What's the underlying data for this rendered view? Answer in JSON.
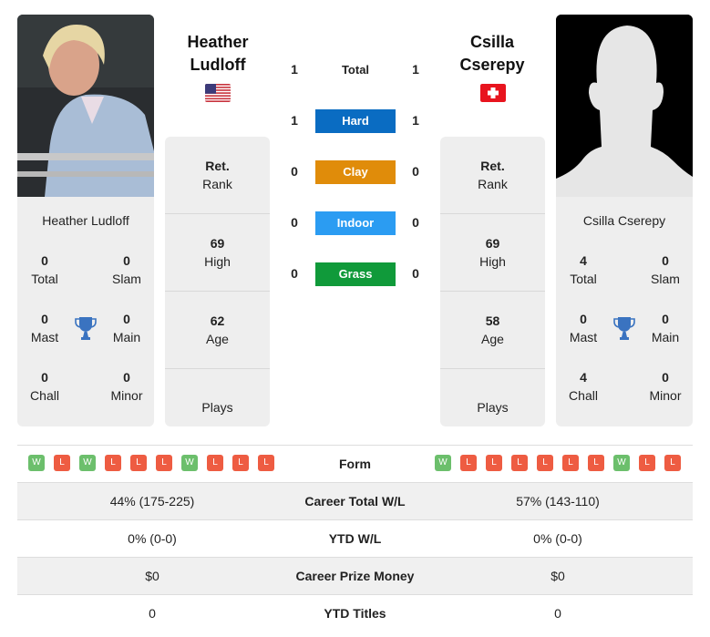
{
  "players": {
    "left": {
      "name": "Heather Ludloff",
      "name_line1": "Heather",
      "name_line2": "Ludloff",
      "country": "USA",
      "flag_icon": "us-flag-icon",
      "titles": {
        "total": {
          "value": "0",
          "label": "Total"
        },
        "slam": {
          "value": "0",
          "label": "Slam"
        },
        "mast": {
          "value": "0",
          "label": "Mast"
        },
        "main": {
          "value": "0",
          "label": "Main"
        },
        "chall": {
          "value": "0",
          "label": "Chall"
        },
        "minor": {
          "value": "0",
          "label": "Minor"
        }
      },
      "info": {
        "rank": {
          "value": "Ret.",
          "label": "Rank"
        },
        "high": {
          "value": "69",
          "label": "High"
        },
        "age": {
          "value": "62",
          "label": "Age"
        },
        "plays": {
          "value": "",
          "label": "Plays"
        }
      },
      "form": [
        "W",
        "L",
        "W",
        "L",
        "L",
        "L",
        "W",
        "L",
        "L",
        "L"
      ]
    },
    "right": {
      "name": "Csilla Cserepy",
      "name_line1": "Csilla",
      "name_line2": "Cserepy",
      "country": "Switzerland",
      "flag_icon": "swiss-flag-icon",
      "titles": {
        "total": {
          "value": "4",
          "label": "Total"
        },
        "slam": {
          "value": "0",
          "label": "Slam"
        },
        "mast": {
          "value": "0",
          "label": "Mast"
        },
        "main": {
          "value": "0",
          "label": "Main"
        },
        "chall": {
          "value": "4",
          "label": "Chall"
        },
        "minor": {
          "value": "0",
          "label": "Minor"
        }
      },
      "info": {
        "rank": {
          "value": "Ret.",
          "label": "Rank"
        },
        "high": {
          "value": "69",
          "label": "High"
        },
        "age": {
          "value": "58",
          "label": "Age"
        },
        "plays": {
          "value": "",
          "label": "Plays"
        }
      },
      "form": [
        "W",
        "L",
        "L",
        "L",
        "L",
        "L",
        "L",
        "W",
        "L",
        "L"
      ]
    }
  },
  "h2h": [
    {
      "label": "Total",
      "left": "1",
      "right": "1",
      "color": ""
    },
    {
      "label": "Hard",
      "left": "1",
      "right": "1",
      "color": "#0a6cc2"
    },
    {
      "label": "Clay",
      "left": "0",
      "right": "0",
      "color": "#e08c0a"
    },
    {
      "label": "Indoor",
      "left": "0",
      "right": "0",
      "color": "#2b9cf2"
    },
    {
      "label": "Grass",
      "left": "0",
      "right": "0",
      "color": "#109a3a"
    }
  ],
  "comparison": {
    "form_label": "Form",
    "rows": [
      {
        "label": "Career Total W/L",
        "left": "44% (175-225)",
        "right": "57% (143-110)"
      },
      {
        "label": "YTD W/L",
        "left": "0% (0-0)",
        "right": "0% (0-0)"
      },
      {
        "label": "Career Prize Money",
        "left": "$0",
        "right": "$0"
      },
      {
        "label": "YTD Titles",
        "left": "0",
        "right": "0"
      }
    ]
  }
}
